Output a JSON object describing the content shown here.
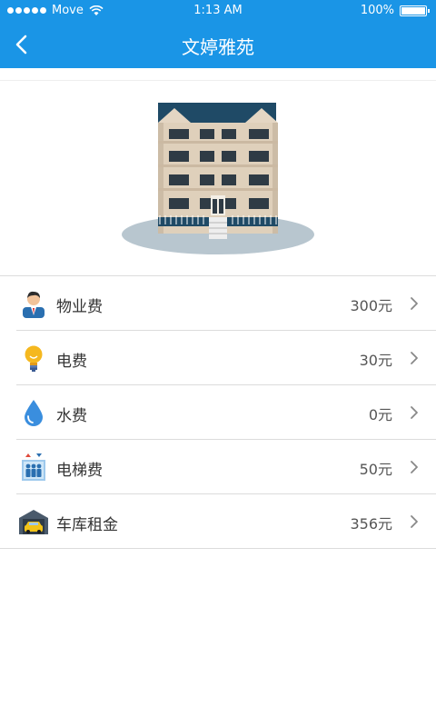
{
  "status_bar": {
    "carrier": "Move",
    "time": "1:13 AM",
    "battery": "100%"
  },
  "nav": {
    "title": "文婷雅苑",
    "back_icon": "chevron-left-icon"
  },
  "colors": {
    "accent": "#1a95e6",
    "divider": "#dcdcdc"
  },
  "fees": [
    {
      "label": "物业费",
      "value": "300元",
      "icon": "property-manager-icon"
    },
    {
      "label": "电费",
      "value": "30元",
      "icon": "lightbulb-icon"
    },
    {
      "label": "水费",
      "value": "0元",
      "icon": "water-drop-icon"
    },
    {
      "label": "电梯费",
      "value": "50元",
      "icon": "elevator-icon"
    },
    {
      "label": "车库租金",
      "value": "356元",
      "icon": "garage-car-icon"
    }
  ]
}
